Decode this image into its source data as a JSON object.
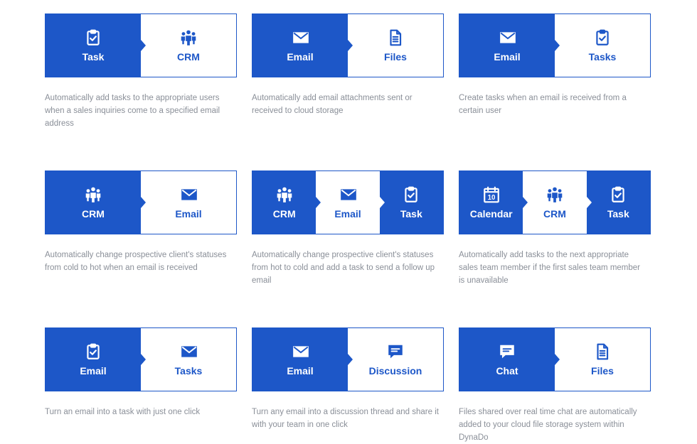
{
  "colors": {
    "primary": "#1d57c8",
    "text_muted": "#8a8f98",
    "background": "#ffffff"
  },
  "cards": [
    {
      "segments": [
        {
          "label": "Task",
          "icon": "clipboard-check-icon",
          "style": "blue"
        },
        {
          "label": "CRM",
          "icon": "people-group-icon",
          "style": "white"
        }
      ],
      "description": "Automatically add tasks to the appropriate users when a sales inquiries come to a specified email address"
    },
    {
      "segments": [
        {
          "label": "Email",
          "icon": "envelope-icon",
          "style": "blue"
        },
        {
          "label": "Files",
          "icon": "document-icon",
          "style": "white"
        }
      ],
      "description": "Automatically add email attachments sent or received to cloud storage"
    },
    {
      "segments": [
        {
          "label": "Email",
          "icon": "envelope-icon",
          "style": "blue"
        },
        {
          "label": "Tasks",
          "icon": "clipboard-check-icon",
          "style": "white"
        }
      ],
      "description": "Create tasks when an email is received from a certain user"
    },
    {
      "segments": [
        {
          "label": "CRM",
          "icon": "people-group-icon",
          "style": "blue"
        },
        {
          "label": "Email",
          "icon": "envelope-icon",
          "style": "white"
        }
      ],
      "description": "Automatically change prospective client's statuses from cold to hot when an email is received"
    },
    {
      "segments": [
        {
          "label": "CRM",
          "icon": "people-group-icon",
          "style": "blue"
        },
        {
          "label": "Email",
          "icon": "envelope-icon",
          "style": "white"
        },
        {
          "label": "Task",
          "icon": "clipboard-check-icon",
          "style": "blue"
        }
      ],
      "description": "Automatically change prospective client's statuses from hot to cold and add a task to send a follow up email"
    },
    {
      "segments": [
        {
          "label": "Calendar",
          "icon": "calendar-icon",
          "style": "blue",
          "icon_text": "10"
        },
        {
          "label": "CRM",
          "icon": "people-group-icon",
          "style": "white"
        },
        {
          "label": "Task",
          "icon": "clipboard-check-icon",
          "style": "blue"
        }
      ],
      "description": "Automatically add tasks to the next appropriate sales team member if the first sales team member is unavailable"
    },
    {
      "segments": [
        {
          "label": "Email",
          "icon": "clipboard-check-icon",
          "style": "blue"
        },
        {
          "label": "Tasks",
          "icon": "envelope-icon",
          "style": "white"
        }
      ],
      "description": "Turn an email into a task with just one click"
    },
    {
      "segments": [
        {
          "label": "Email",
          "icon": "envelope-icon",
          "style": "blue"
        },
        {
          "label": "Discussion",
          "icon": "chat-bubble-icon",
          "style": "white"
        }
      ],
      "description": "Turn any email into a discussion thread and share it with your team in one click"
    },
    {
      "segments": [
        {
          "label": "Chat",
          "icon": "chat-bubble-icon",
          "style": "blue"
        },
        {
          "label": "Files",
          "icon": "document-icon",
          "style": "white"
        }
      ],
      "description": "Files shared over real time chat are automatically added to your cloud file storage system within DynaDo"
    }
  ]
}
